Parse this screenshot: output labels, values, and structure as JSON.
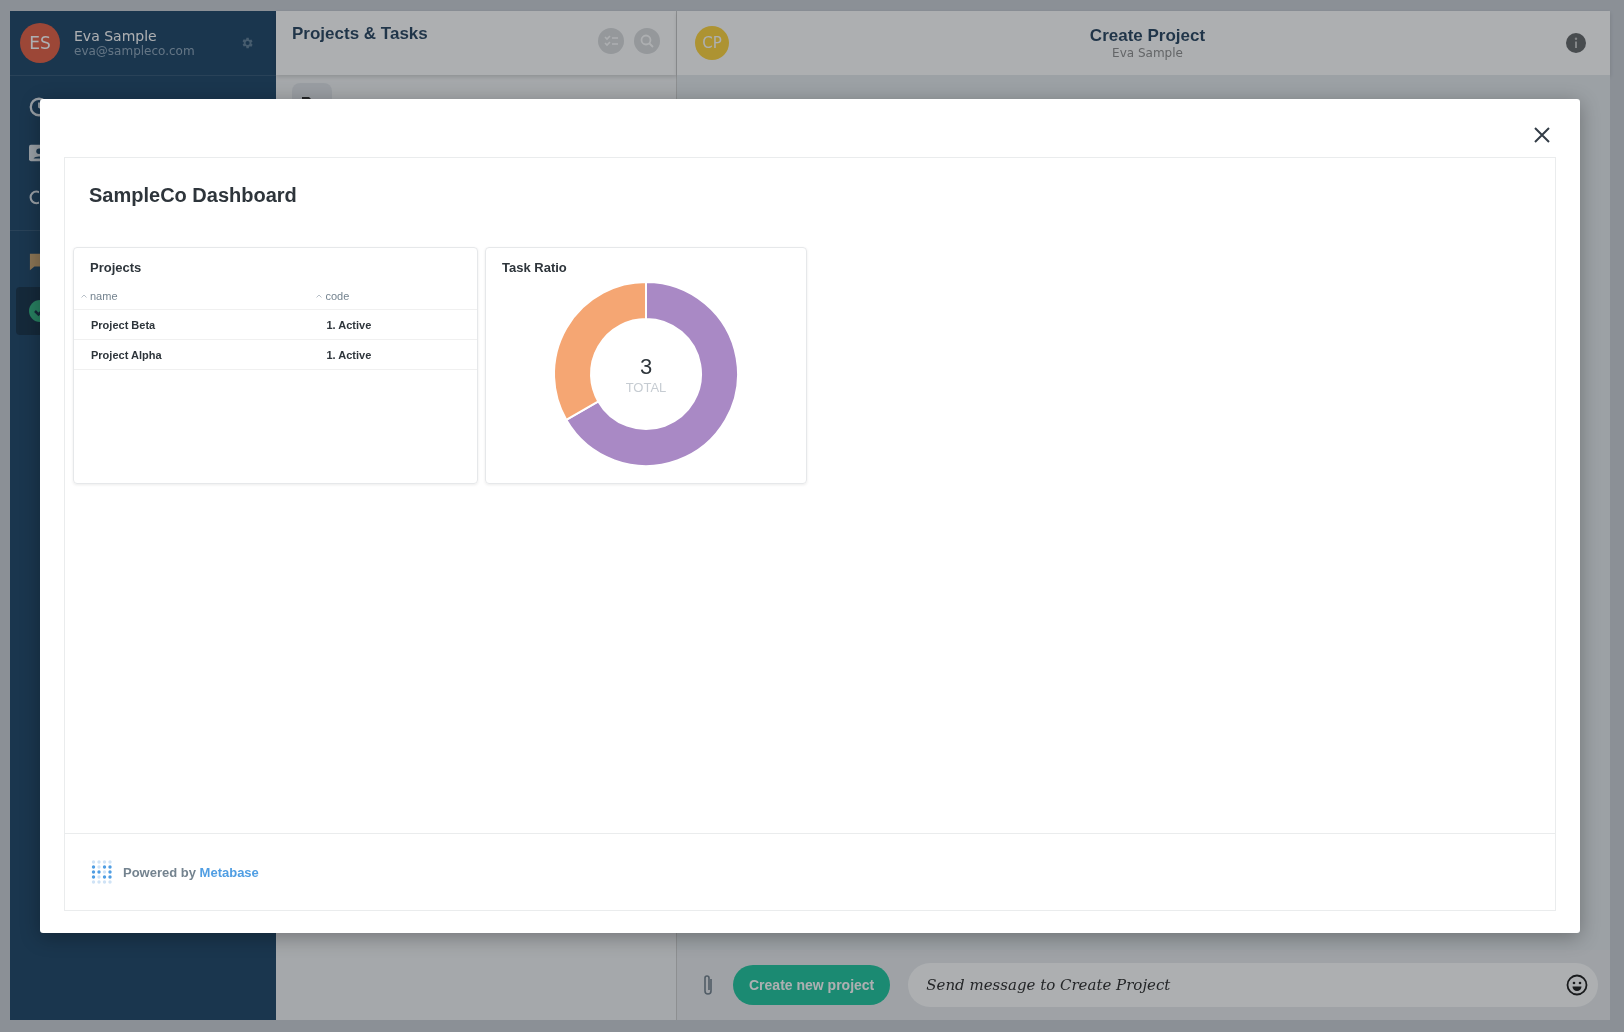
{
  "user": {
    "initials": "ES",
    "name": "Eva Sample",
    "email": "eva@sampleco.com"
  },
  "sidebar": {
    "items": [
      {
        "kind": "clock",
        "selected": false
      },
      {
        "kind": "contact",
        "selected": false
      },
      {
        "kind": "search",
        "selected": false
      },
      {
        "kind": "chat",
        "selected": false
      },
      {
        "kind": "check",
        "selected": true
      }
    ]
  },
  "projects_panel": {
    "title": "Projects & Tasks"
  },
  "chat": {
    "avatar": "CP",
    "title": "Create Project",
    "subtitle": "Eva Sample",
    "action_button": "Create new project",
    "message_placeholder": "Send message to Create Project"
  },
  "modal": {
    "dashboard_title": "SampleCo Dashboard",
    "cards": [
      {
        "kind": "table",
        "title": "Projects",
        "columns": [
          "name",
          "code"
        ],
        "rows": [
          [
            "Project Beta",
            "1. Active"
          ],
          [
            "Project Alpha",
            "1. Active"
          ]
        ]
      },
      {
        "kind": "donut",
        "title": "Task Ratio",
        "total": "3",
        "total_label": "TOTAL",
        "chart_data": {
          "type": "donut",
          "values": [
            66.7,
            33.3
          ],
          "colors": [
            "#a989c5",
            "#f5a673"
          ]
        }
      }
    ],
    "footer": {
      "prefix": "Powered by",
      "link": "Metabase"
    }
  }
}
